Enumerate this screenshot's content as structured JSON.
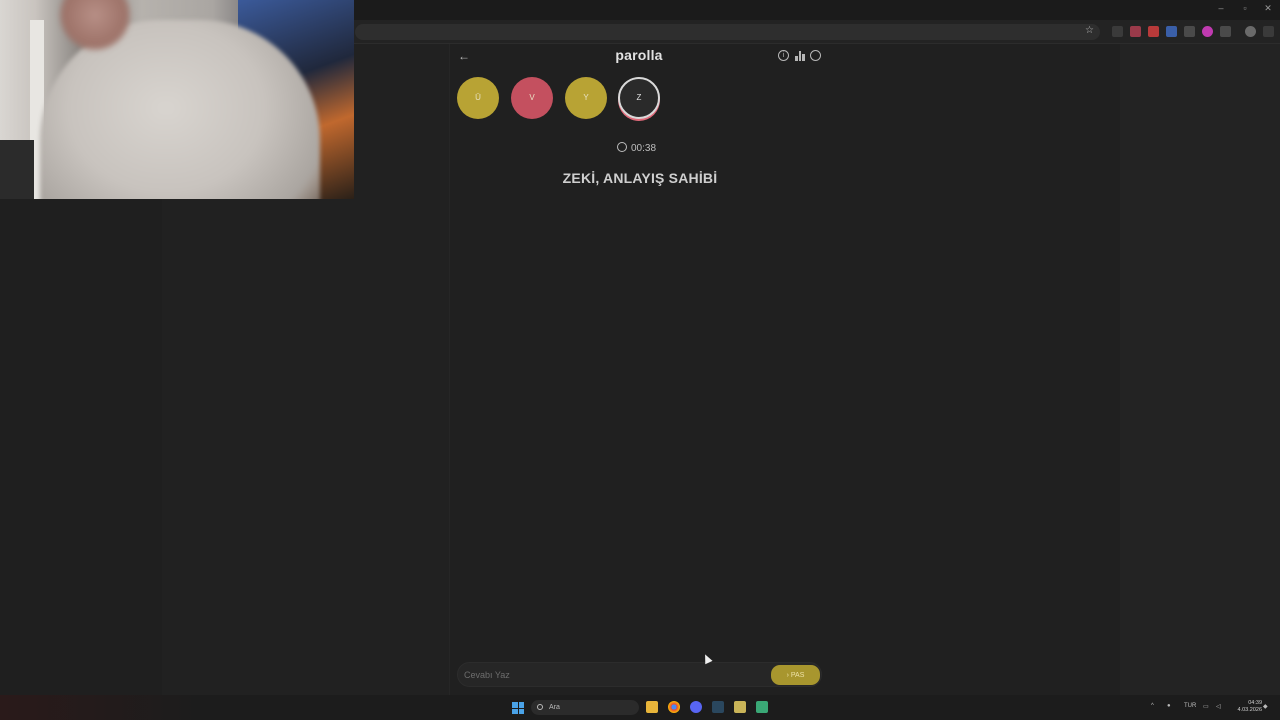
{
  "browser": {
    "window_controls": {
      "minimize": "–",
      "maximize": "▫",
      "close": "✕"
    },
    "star_icon": "star-icon"
  },
  "app": {
    "logo": "parolla",
    "header_icons": [
      "info-icon",
      "stats-icon",
      "profile-icon"
    ],
    "letters": [
      {
        "letter": "Ü",
        "state": "answered",
        "color": "#b8a334"
      },
      {
        "letter": "V",
        "state": "wrong",
        "color": "#c4505f"
      },
      {
        "letter": "Y",
        "state": "answered",
        "color": "#b8a334"
      },
      {
        "letter": "Z",
        "state": "active",
        "color": "#2a2a2a"
      }
    ],
    "timer": "00:38",
    "question": "ZEKİ, ANLAYIŞ SAHİBİ",
    "answer": {
      "placeholder": "Cevabı Yaz",
      "value": "",
      "pass_label": "› PAS",
      "pass_color": "#a8962e"
    }
  },
  "taskbar": {
    "search_placeholder": "Ara",
    "language": "TUR",
    "time": "04:39",
    "date": "4.03.2026"
  }
}
